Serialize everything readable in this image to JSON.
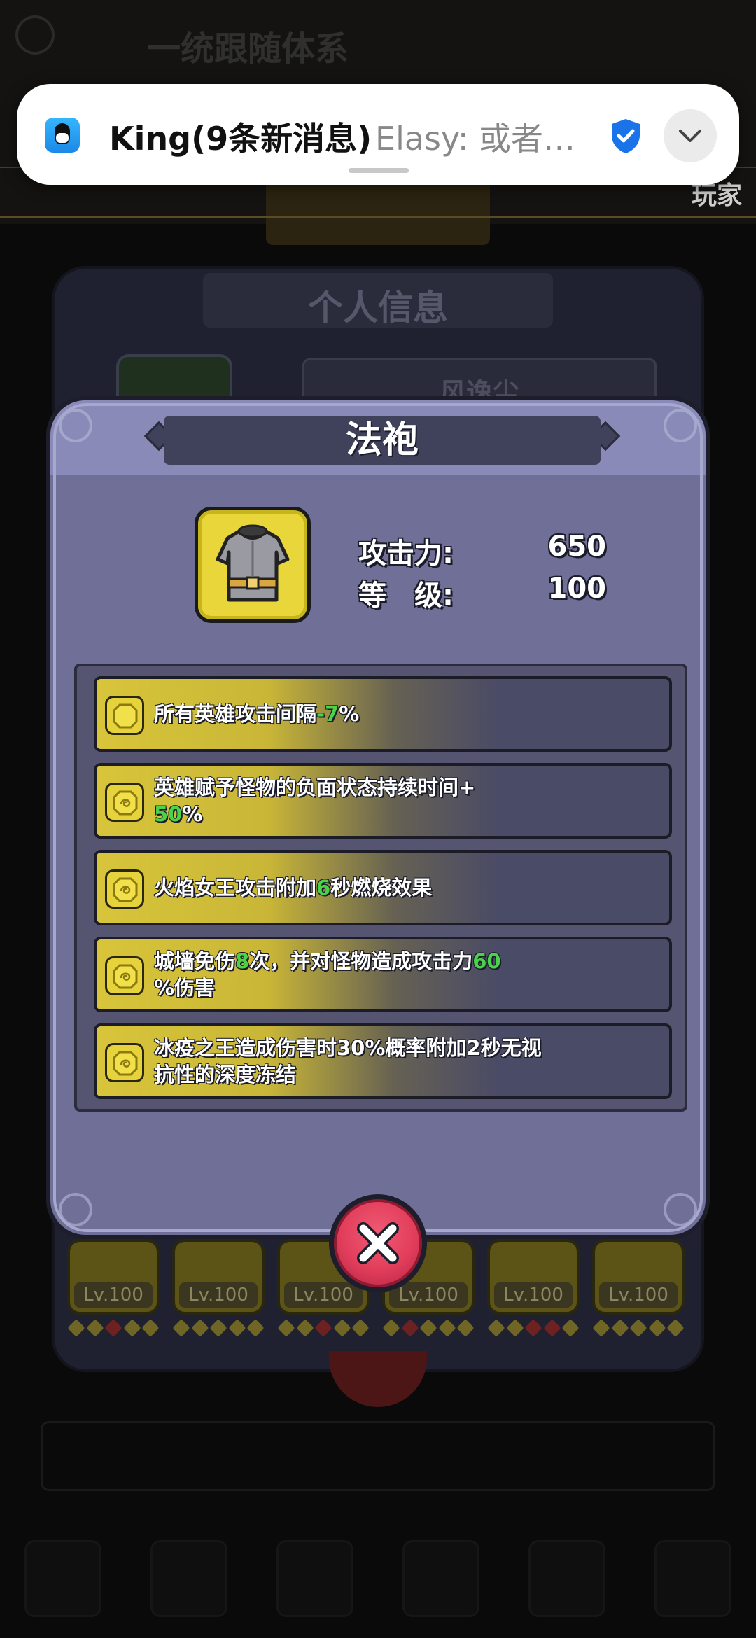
{
  "background": {
    "faint_header_text": "一统跟随体系",
    "player_label": "玩家",
    "panel_title": "个人信息",
    "player_name": "风逸尘",
    "equipment_slots": [
      {
        "level": "Lv.100"
      },
      {
        "level": "Lv.100"
      },
      {
        "level": "Lv.100"
      },
      {
        "level": "Lv.100"
      },
      {
        "level": "Lv.100"
      },
      {
        "level": "Lv.100"
      }
    ]
  },
  "notification": {
    "app_icon": "qq-penguin-icon",
    "title": "King(9条新消息)",
    "preview": "Elasy: 或者…",
    "verified_icon": "shield-check-icon",
    "expand_icon": "chevron-down-icon"
  },
  "dialog": {
    "title": "法袍",
    "item_icon": "armor-robe-icon",
    "stats": {
      "attack_label": "攻击力:",
      "attack_value": "650",
      "level_label": "等　级:",
      "level_value": "100"
    },
    "effects": [
      {
        "text_before": "所有英雄攻击间隔",
        "highlight": "-7",
        "text_after": "%"
      },
      {
        "text_before": "英雄赋予怪物的负面状态持续时间+",
        "highlight": "50",
        "text_after": "%"
      },
      {
        "text_before": "火焰女王攻击附加",
        "highlight": "6",
        "text_after": "秒燃烧效果"
      },
      {
        "text_before": "城墙免伤",
        "highlight": "8",
        "text_mid": "次，并对怪物造成攻击力",
        "highlight2": "60",
        "text_after": "%伤害"
      },
      {
        "text_before": "冰疫之王造成伤害时30%概率附加2秒无视抗性的深度冻结"
      }
    ],
    "close_icon": "close-x-icon"
  },
  "colors": {
    "highlight_green": "#4bd24b",
    "dialog_bg": "#6f6f98",
    "effect_gold": "#d8c53a",
    "close_red": "#e23e5c"
  }
}
